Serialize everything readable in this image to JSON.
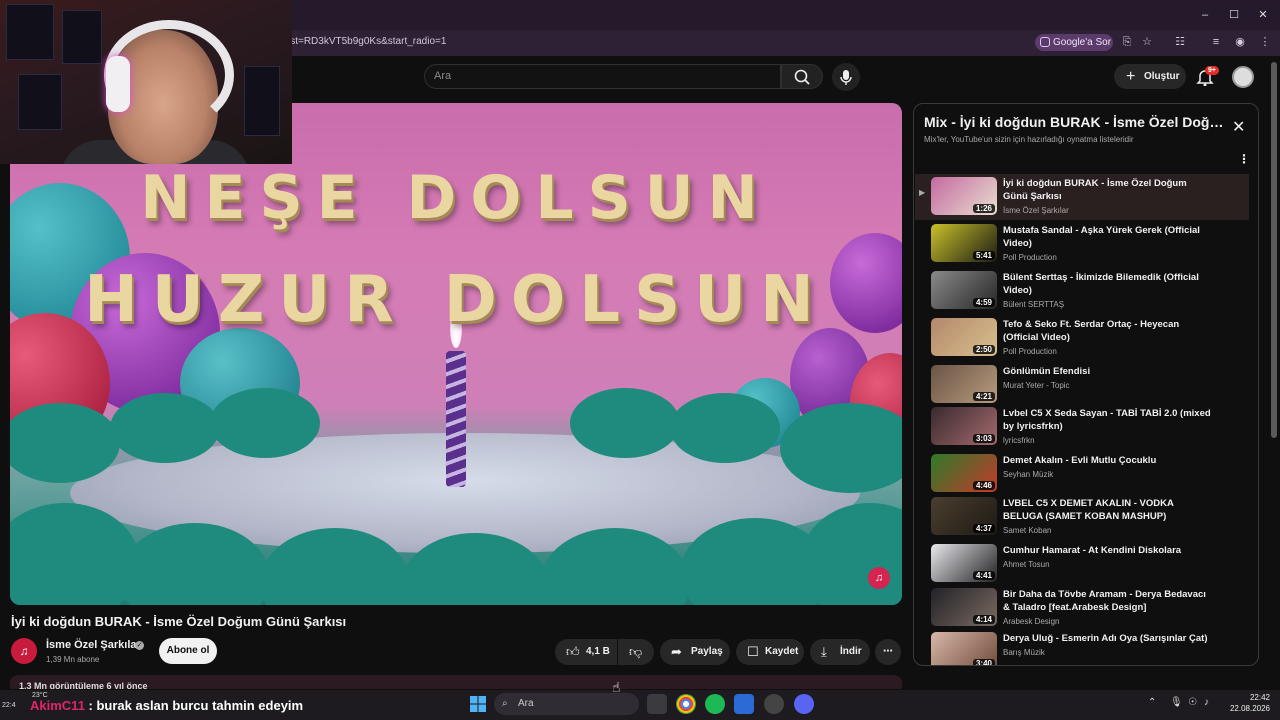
{
  "browser": {
    "url_fragment": "ist=RD3kVT5b9g0Ks&start_radio=1",
    "google_sor": "Google'a Sor",
    "window_controls": [
      "minimize-icon",
      "maximize-icon",
      "close-icon"
    ]
  },
  "header": {
    "search_placeholder": "Ara",
    "create_label": "Oluştur",
    "notif_badge": "9+"
  },
  "video": {
    "overlay_line1": "NEŞE DOLSUN",
    "overlay_line2": "HUZUR DOLSUN",
    "title": "İyi ki doğdun BURAK - İsme Özel Doğum Günü Şarkısı",
    "channel": "İsme Özel Şarkılar",
    "subscribers": "1,39 Mn abone",
    "subscribe_label": "Abone ol",
    "likes": "4,1 B",
    "share_label": "Paylaş",
    "save_label": "Kaydet",
    "download_label": "İndir",
    "description_preview": "1,3 Mn görüntüleme  6 yıl önce"
  },
  "playlist": {
    "title": "Mix - İyi ki doğdun BURAK - İsme Özel Doğum G...",
    "subtitle": "Mix'ler, YouTube'un sizin için hazırladığı oynatma listeleridir",
    "items": [
      {
        "title": "İyi ki doğdun BURAK - İsme Özel Doğum Günü Şarkısı",
        "channel": "İsme Özel Şarkılar",
        "duration": "1:26",
        "thumb": "#c46aa0",
        "thumb2": "#e9dfd0"
      },
      {
        "title": "Mustafa Sandal - Aşka Yürek Gerek (Official Video)",
        "channel": "Poll Production",
        "duration": "5:41",
        "thumb": "#c9c12a",
        "thumb2": "#1c1c14"
      },
      {
        "title": "Bülent Serttaş - İkimizde Bilemedik (Official Video)",
        "channel": "Bülent SERTTAŞ",
        "duration": "4:59",
        "thumb": "#8a8a8a",
        "thumb2": "#262626"
      },
      {
        "title": "Tefo & Seko Ft. Serdar Ortaç - Heyecan (Official Video)",
        "channel": "Poll Production",
        "duration": "2:50",
        "thumb": "#b4886a",
        "thumb2": "#d8c08e"
      },
      {
        "title": "Gönlümün Efendisi",
        "channel": "Murat Yeter - Topic",
        "duration": "4:21",
        "thumb": "#6a5446",
        "thumb2": "#b89c7e"
      },
      {
        "title": "Lvbel C5 X Seda Sayan - TABİ TABİ 2.0 (mixed by lyricsfrkn)",
        "channel": "lyricsfrkn",
        "duration": "3:03",
        "thumb": "#3a2a2e",
        "thumb2": "#a46a6e"
      },
      {
        "title": "Demet Akalın - Evli Mutlu Çocuklu",
        "channel": "Seyhan Müzik",
        "duration": "4:46",
        "thumb": "#2d7a2a",
        "thumb2": "#c43a2a"
      },
      {
        "title": "LVBEL C5 X DEMET AKALIN - VODKA BELUGA (SAMET KOBAN MASHUP)",
        "channel": "Samet Koban",
        "duration": "4:37",
        "thumb": "#4a3e2e",
        "thumb2": "#1e1a16"
      },
      {
        "title": "Cumhur Hamarat - At Kendini Diskolara",
        "channel": "Ahmet Tosun",
        "duration": "4:41",
        "thumb": "#e8e8ee",
        "thumb2": "#222"
      },
      {
        "title": "Bir Daha da Tövbe Aramam - Derya Bedavacı & Taladro [feat.Arabesk Design]",
        "channel": "Arabesk Design",
        "duration": "4:14",
        "thumb": "#222228",
        "thumb2": "#7a6a60"
      },
      {
        "title": "Derya Uluğ - Esmerin Adı Oya (Sarışınlar Çat)",
        "channel": "Barış Müzik",
        "duration": "3:40",
        "thumb": "#d9b7a8",
        "thumb2": "#6e4a3a"
      }
    ]
  },
  "stream": {
    "chat_user": "AkimC11",
    "chat_message": " : burak aslan burcu tahmin edeyim"
  },
  "taskbar": {
    "weather": "23°C",
    "left_time": "22:4",
    "search_label": "Ara",
    "time": "22:42",
    "date": "22.08.2026"
  },
  "colors": {
    "accent": "#e52d27",
    "chat_user": "#e0256b"
  }
}
